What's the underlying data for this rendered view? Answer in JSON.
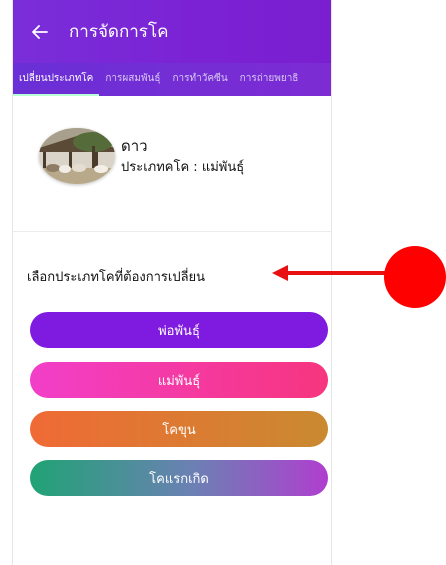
{
  "app_bar": {
    "title": "การจัดการโค",
    "back_icon": "arrow-left-icon"
  },
  "tabs": [
    {
      "label": "เปลี่ยนประเภทโค",
      "active": true
    },
    {
      "label": "การผสมพันธุ์",
      "active": false
    },
    {
      "label": "การทำวัคซีน",
      "active": false
    },
    {
      "label": "การถ่ายพยาธิ",
      "active": false
    }
  ],
  "profile": {
    "name": "ดาว",
    "type_label": "ประเภทคโค : แม่พันธุ์"
  },
  "select": {
    "label": "เลือกประเภทโคที่ต้องการเปลี่ยน"
  },
  "buttons": {
    "sire": "พ่อพันธุ์",
    "dam": "แม่พันธุ์",
    "fattening": "โคขุน",
    "newborn": "โคแรกเกิด"
  },
  "colors": {
    "app_bar": "#7a22d4",
    "sire_button": "#7f1ae0",
    "dam_button": "#f23fc9",
    "fattening_button": "#f06a35",
    "newborn_button": "#20a374",
    "annotation": "#ff0000"
  }
}
